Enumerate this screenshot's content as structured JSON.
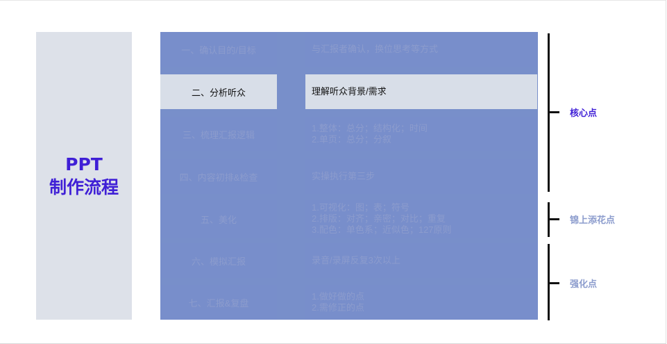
{
  "title_line1": "PPT",
  "title_line2": "制作流程",
  "steps": [
    {
      "step": "一、确认目的/目标",
      "desc": [
        "与汇报者确认，换位思考等方式"
      ]
    },
    {
      "step": "二、分析听众",
      "desc": [
        "理解听众背景/需求"
      ]
    },
    {
      "step": "三、梳理汇报逻辑",
      "desc": [
        "1.整体：总分；结构化；时间",
        "2.单页：总分；分叙"
      ]
    },
    {
      "step": "四、内容初排&检查",
      "desc": [
        "实操执行第三步"
      ]
    },
    {
      "step": "五、美化",
      "desc": [
        "1.可视化：图；表；符号",
        "2.排版：对齐；亲密；对比；重复",
        "3.配色：单色系；近似色；127原则"
      ]
    },
    {
      "step": "六、模拟汇报",
      "desc": [
        "录音/录屏反复3次以上"
      ]
    },
    {
      "step": "七、汇报&复盘",
      "desc": [
        "1.做好做的点",
        "2.需修正的点"
      ]
    }
  ],
  "brackets": [
    {
      "label": "核心点",
      "color": "#3f1fd6"
    },
    {
      "label": "锦上添花点",
      "color": "#8c9ccd"
    },
    {
      "label": "强化点",
      "color": "#8c9ccd"
    }
  ]
}
